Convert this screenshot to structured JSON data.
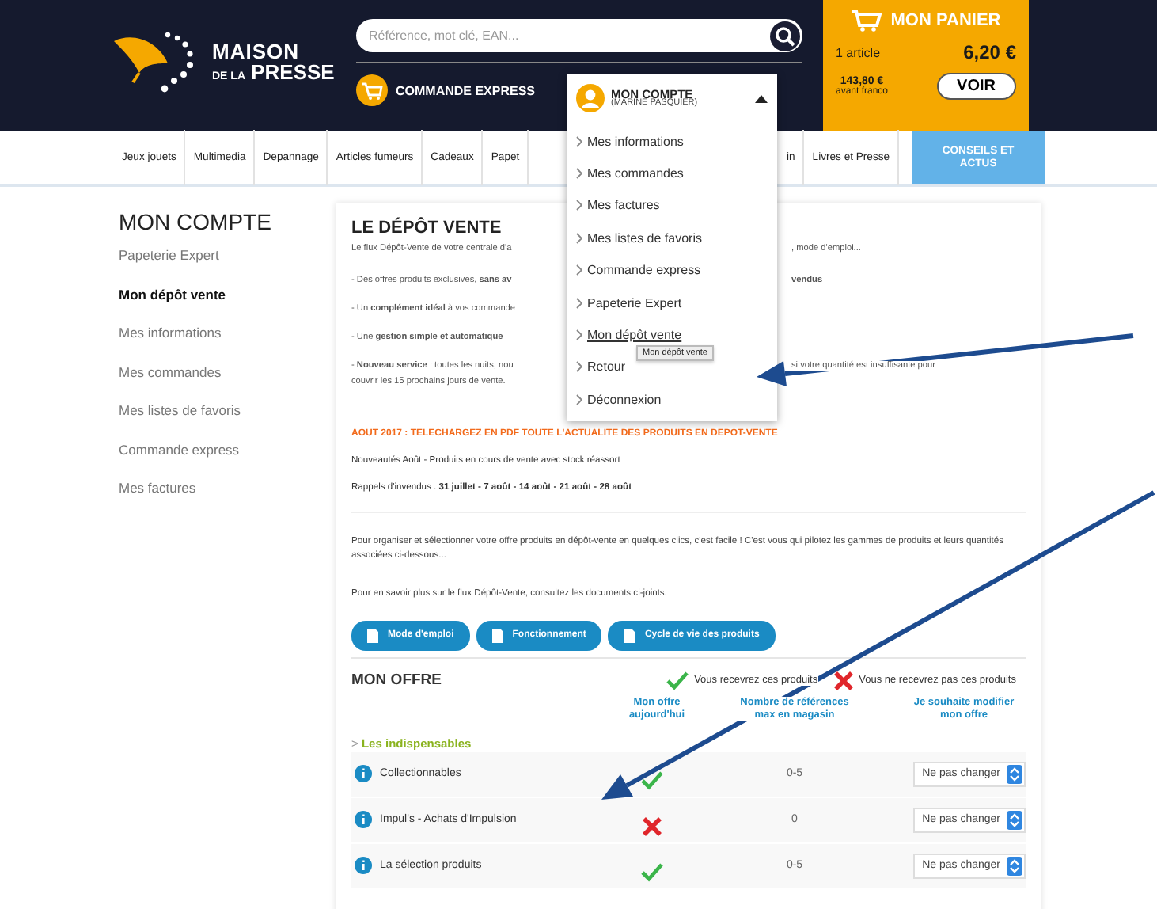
{
  "header": {
    "logo": {
      "line1": "MAISON",
      "line2_prefix": "DE LA",
      "line2": "PRESSE"
    },
    "search": {
      "placeholder": "Référence, mot clé, EAN..."
    },
    "express_button": "COMMANDE EXPRESS",
    "account": {
      "label": "MON COMPTE",
      "user": "(MARINE PASQUIER)",
      "expanded": true
    },
    "cart": {
      "title": "MON PANIER",
      "count": "1 article",
      "total": "6,20 €",
      "franco_amount": "143,80 €",
      "franco_label": "avant franco",
      "button": "VOIR"
    }
  },
  "nav": {
    "left": [
      "Jeux jouets",
      "Multimedia",
      "Depannage",
      "Articles fumeurs",
      "Cadeaux",
      "Papet"
    ],
    "right": [
      "in",
      "Livres et Presse"
    ],
    "feature": "CONSEILS ET ACTUS"
  },
  "account_menu": {
    "items": [
      {
        "label": "Mes informations",
        "selected": false
      },
      {
        "label": "Mes commandes",
        "selected": false
      },
      {
        "label": "Mes factures",
        "selected": false
      },
      {
        "label": "Mes listes de favoris",
        "selected": false
      },
      {
        "label": "Commande express",
        "selected": false
      },
      {
        "label": "Papeterie Expert",
        "selected": false
      },
      {
        "label": "Mon dépôt vente",
        "selected": true
      },
      {
        "label": "Retour",
        "selected": false
      },
      {
        "label": "Déconnexion",
        "selected": false
      }
    ],
    "tooltip": "Mon dépôt vente"
  },
  "sidebar": {
    "title": "MON COMPTE",
    "items": [
      {
        "label": "Papeterie Expert",
        "selected": false
      },
      {
        "label": "Mon dépôt vente",
        "selected": true
      },
      {
        "label": "Mes informations",
        "selected": false
      },
      {
        "label": "Mes commandes",
        "selected": false
      },
      {
        "label": "Mes listes de favoris",
        "selected": false
      },
      {
        "label": "Commande express",
        "selected": false
      },
      {
        "label": "Mes factures",
        "selected": false
      }
    ]
  },
  "content": {
    "title": "LE DÉPÔT VENTE",
    "lines": [
      {
        "left": "Le flux Dépôt-Vente de votre centrale d'a",
        "right": ", mode d'emploi..."
      },
      {
        "left": "- Des offres produits exclusives, **sans av**",
        "right": "**vendus**"
      },
      {
        "left": "- Un **complément idéal** à vos commande"
      },
      {
        "left": "- Une **gestion simple et automatique**"
      },
      {
        "left": "- **Nouveau service** : toutes les nuits, nou",
        "right": "si votre quantité est insuffisante pour",
        "more": "couvrir les 15 prochains jours de vente."
      }
    ],
    "headline": "AOUT 2017 : TELECHARGEZ EN PDF TOUTE L'ACTUALITE DES PRODUITS EN DEPOT-VENTE",
    "news": [
      "Nouveautés Août - Produits en cours de vente avec stock réassort",
      "Rappels d'invendus : **31 juillet - 7 août - 14 août - 21 août - 28 août**"
    ],
    "intro": "Pour organiser et sélectionner votre offre produits en dépôt-vente en quelques clics, c'est facile ! C'est vous qui pilotez les gammes de produits et leurs quantités associées ci-dessous...",
    "more": "Pour en savoir plus sur le flux Dépôt-Vente, consultez les documents ci-joints.",
    "documents": [
      "Mode d'emploi",
      "Fonctionnement",
      "Cycle de vie des produits"
    ]
  },
  "offer": {
    "title": "MON OFFRE",
    "legend_yes": "Vous recevrez ces produits",
    "legend_no": "Vous ne recevrez pas ces produits",
    "columns": [
      "Mon offre aujourd'hui",
      "Nombre de références max en magasin",
      "Je souhaite modifier mon offre"
    ],
    "group_marker": ">",
    "group": "Les indispensables",
    "rows": [
      {
        "name": "Collectionnables",
        "received": true,
        "max": "0-5",
        "choice": "Ne pas changer"
      },
      {
        "name": "Impul's - Achats d'Impulsion",
        "received": false,
        "max": "0",
        "choice": "Ne pas changer"
      },
      {
        "name": "La sélection produits",
        "received": true,
        "max": "0-5",
        "choice": "Ne pas changer"
      }
    ]
  }
}
